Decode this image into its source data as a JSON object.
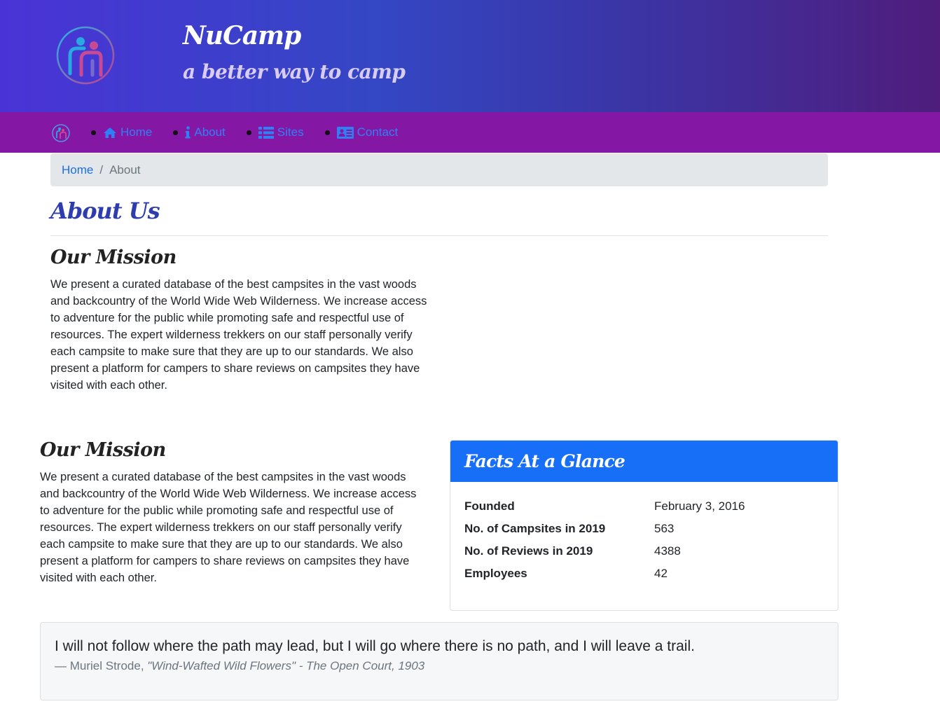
{
  "header": {
    "title": "NuCamp",
    "subtitle": "a better way to camp",
    "logo_icon": "nucamp-logo-icon"
  },
  "nav": {
    "items": [
      {
        "label": "Home",
        "icon": "home-icon"
      },
      {
        "label": "About",
        "icon": "info-icon"
      },
      {
        "label": "Sites",
        "icon": "list-icon"
      },
      {
        "label": "Contact",
        "icon": "address-card-icon"
      }
    ],
    "link_color": "#2f80f5",
    "background": "#8418a5"
  },
  "breadcrumb": {
    "home": "Home",
    "separator": "/",
    "current": "About"
  },
  "main": {
    "title": "About Us",
    "mission_top": {
      "heading": "Our Mission",
      "body": "We present a curated database of the best campsites in the vast woods and backcountry of the World Wide Web Wilderness. We increase access to adventure for the public while promoting safe and respectful use of resources. The expert wilderness trekkers on our staff personally verify each campsite to make sure that they are up to our standards. We also present a platform for campers to share reviews on campsites they have visited with each other."
    },
    "mission_bottom": {
      "heading": "Our Mission",
      "body": "We present a curated database of the best campsites in the vast woods and backcountry of the World Wide Web Wilderness. We increase access to adventure for the public while promoting safe and respectful use of resources. The expert wilderness trekkers on our staff personally verify each campsite to make sure that they are up to our standards. We also present a platform for campers to share reviews on campsites they have visited with each other."
    }
  },
  "facts": {
    "title": "Facts At a Glance",
    "header_color": "#176ef7",
    "rows": [
      {
        "label": "Founded",
        "value": "February 3, 2016"
      },
      {
        "label": "No. of Campsites in 2019",
        "value": "563"
      },
      {
        "label": "No. of Reviews in 2019",
        "value": "4388"
      },
      {
        "label": "Employees",
        "value": "42"
      }
    ]
  },
  "quote": {
    "text": "I will not follow where the path may lead, but I will go where there is no path, and I will leave a trail.",
    "author": "— Muriel Strode, ",
    "source": "\"Wind-Wafted Wild Flowers\" - The Open Court, 1903"
  }
}
